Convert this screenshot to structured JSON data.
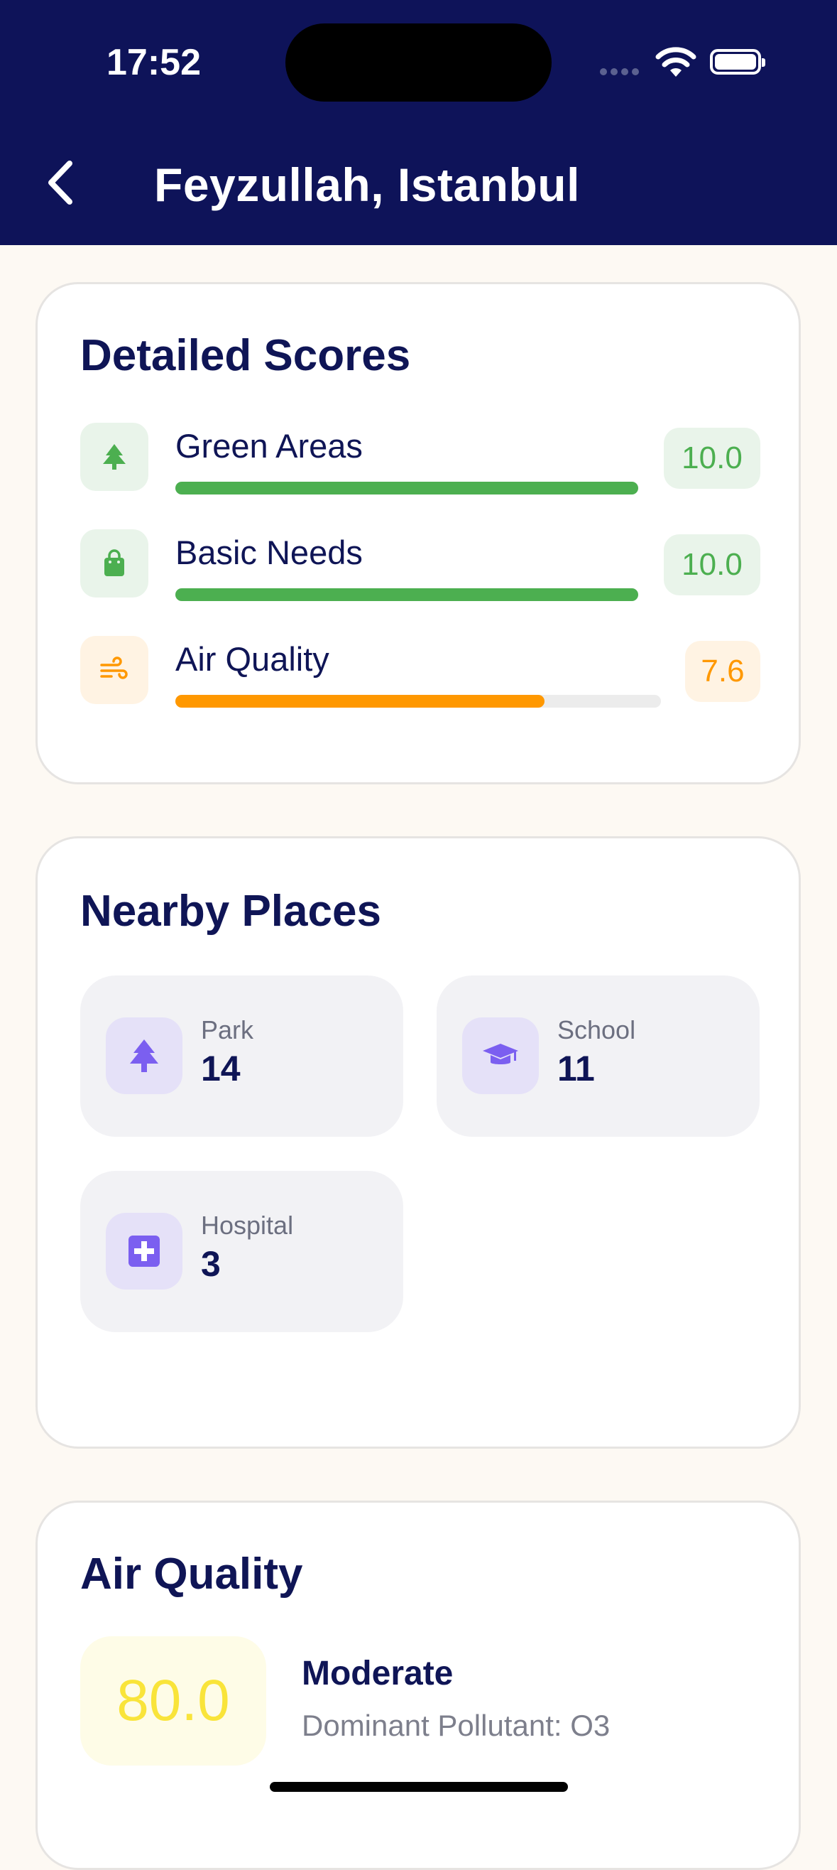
{
  "status_bar": {
    "time": "17:52"
  },
  "header": {
    "title": "Feyzullah, Istanbul"
  },
  "detailed_scores": {
    "title": "Detailed Scores",
    "items": [
      {
        "label": "Green Areas",
        "value": "10.0",
        "fraction": 1.0,
        "color": "#4caf50",
        "badge_bg": "#e9f4ea",
        "icon_bg": "#e9f4ea",
        "icon": "tree-icon"
      },
      {
        "label": "Basic Needs",
        "value": "10.0",
        "fraction": 1.0,
        "color": "#4caf50",
        "badge_bg": "#e9f4ea",
        "icon_bg": "#e9f4ea",
        "icon": "shopping-bag-icon"
      },
      {
        "label": "Air Quality",
        "value": "7.6",
        "fraction": 0.76,
        "color": "#ff9800",
        "badge_bg": "#fff3e3",
        "icon_bg": "#fff3e3",
        "icon": "wind-icon"
      }
    ]
  },
  "nearby_places": {
    "title": "Nearby Places",
    "items": [
      {
        "name": "Park",
        "count": "14",
        "icon": "tree-icon"
      },
      {
        "name": "School",
        "count": "11",
        "icon": "graduation-cap-icon"
      },
      {
        "name": "Hospital",
        "count": "3",
        "icon": "medical-cross-icon"
      }
    ],
    "accent": "#7b5ff0"
  },
  "air_quality": {
    "title": "Air Quality",
    "index": "80.0",
    "status": "Moderate",
    "pollutant": "Dominant Pollutant: O3",
    "index_color": "#f9e43a"
  }
}
